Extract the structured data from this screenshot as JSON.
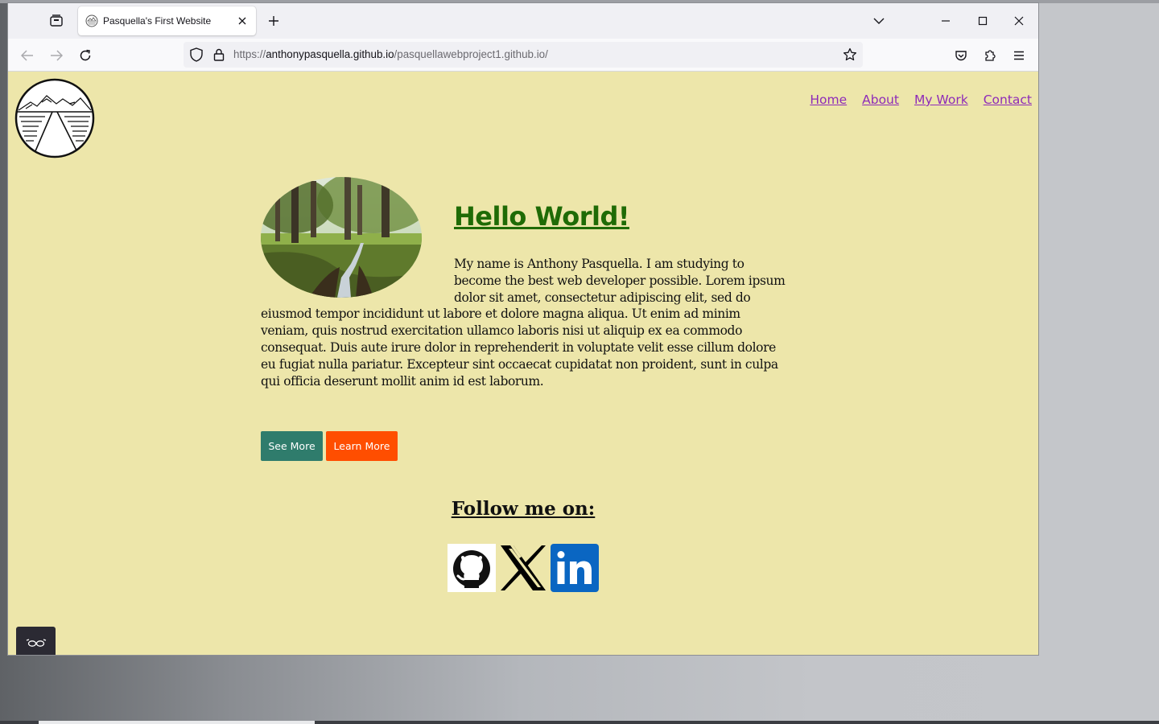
{
  "browser": {
    "tab": {
      "title": "Pasquella's First Website"
    },
    "url": {
      "prefix": "https://",
      "host": "anthonypasquella.github.io",
      "path": "/pasquellawebproject1.github.io/"
    }
  },
  "site": {
    "nav": [
      {
        "label": "Home"
      },
      {
        "label": "About"
      },
      {
        "label": "My Work"
      },
      {
        "label": "Contact"
      }
    ],
    "hero": {
      "heading": "Hello World!",
      "intro": "My name is Anthony Pasquella. I am studying to become the best web developer possible. Lorem ipsum dolor sit amet, consectetur adipiscing elit, sed do eiusmod tempor incididunt ut labore et dolore magna aliqua. Ut enim ad minim veniam, quis nostrud exercitation ullamco laboris nisi ut aliquip ex ea commodo consequat. Duis aute irure dolor in reprehenderit in voluptate velit esse cillum dolore eu fugiat nulla pariatur. Excepteur sint occaecat cupidatat non proident, sunt in culpa qui officia deserunt mollit anim id est laborum."
    },
    "buttons": {
      "see_more": "See More",
      "learn_more": "Learn More"
    },
    "follow": {
      "heading": "Follow me on:",
      "icons": [
        "github-icon",
        "x-icon",
        "linkedin-icon"
      ]
    }
  },
  "colors": {
    "page_bg": "#ede6aa",
    "nav_link": "#8e2bb8",
    "heading_green": "#1f6b06",
    "see_more_bg": "#2f7c6c",
    "learn_more_bg": "#ff4e00",
    "linkedin_blue": "#0a66c2"
  }
}
